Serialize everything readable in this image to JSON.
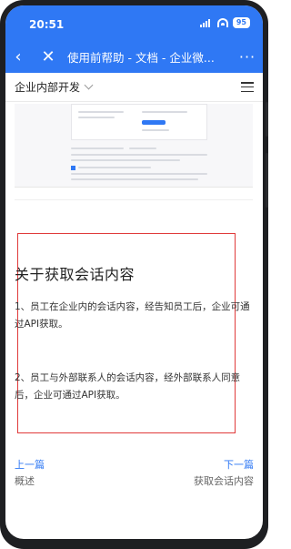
{
  "status_bar": {
    "time": "20:51",
    "network": "5G",
    "battery": "95"
  },
  "title_bar": {
    "title": "使用前帮助 - 文档 - 企业微..."
  },
  "nav": {
    "section": "企业内部开发"
  },
  "article": {
    "heading": "关于获取会话内容",
    "paragraphs": [
      "1、员工在企业内的会话内容，经告知员工后，企业可通过API获取。",
      "2、员工与外部联系人的会话内容，经外部联系人同意后，企业可通过API获取。"
    ]
  },
  "pager": {
    "prev_label": "上一篇",
    "prev_title": "概述",
    "next_label": "下一篇",
    "next_title": "获取会话内容"
  },
  "colors": {
    "brand": "#2f78f4",
    "highlight": "#e03a3a"
  }
}
